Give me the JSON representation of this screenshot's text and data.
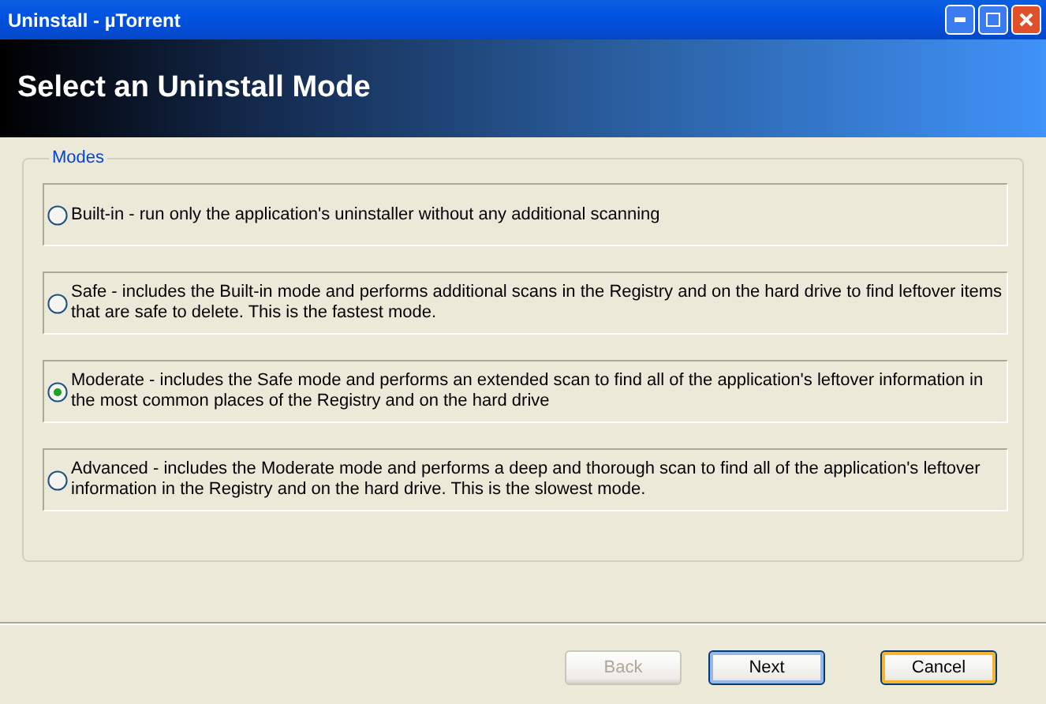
{
  "window": {
    "title": "Uninstall - µTorrent"
  },
  "header": {
    "title": "Select an Uninstall Mode"
  },
  "modes": {
    "label": "Modes",
    "options": [
      {
        "text": "Built-in - run only the application's uninstaller without any additional scanning",
        "selected": false
      },
      {
        "text": "Safe - includes the Built-in mode and performs additional scans in the Registry and on the hard drive to find leftover items that are safe to delete. This is the fastest mode.",
        "selected": false
      },
      {
        "text": "Moderate - includes the Safe mode and performs an extended scan to find all of the application's leftover information in the most common places of the Registry and on the hard drive",
        "selected": true
      },
      {
        "text": "Advanced - includes the Moderate mode and performs a deep and thorough scan to find all of the application's leftover information in the Registry and on the hard drive. This is the slowest mode.",
        "selected": false
      }
    ]
  },
  "buttons": [
    {
      "label": "Back",
      "disabled": true,
      "focused": false,
      "hovered": false
    },
    {
      "label": "Next",
      "disabled": false,
      "focused": true,
      "hovered": false
    },
    {
      "label": "Cancel",
      "disabled": false,
      "focused": false,
      "hovered": true
    }
  ]
}
